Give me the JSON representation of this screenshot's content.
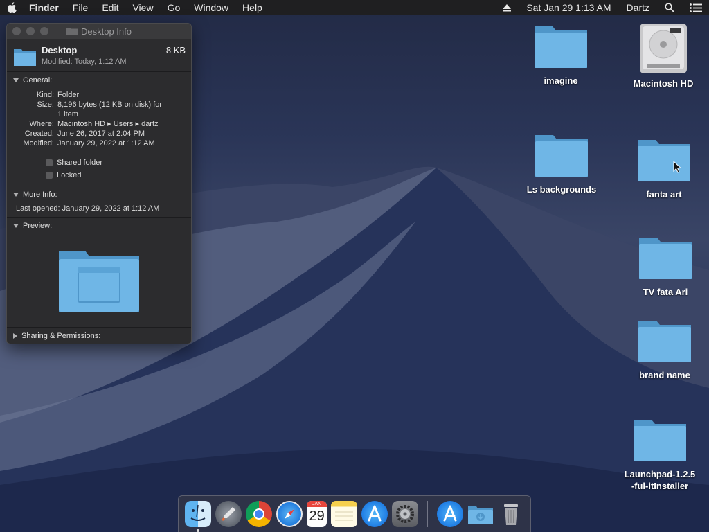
{
  "menubar": {
    "app": "Finder",
    "items": [
      "File",
      "Edit",
      "View",
      "Go",
      "Window",
      "Help"
    ],
    "clock": "Sat Jan 29  1:13 AM",
    "user": "Dartz"
  },
  "info_window": {
    "title": "Desktop Info",
    "name": "Desktop",
    "size": "8 KB",
    "modified_short": "Modified: Today, 1:12 AM",
    "general": {
      "title": "General:",
      "kind_label": "Kind:",
      "kind": "Folder",
      "size_label": "Size:",
      "size_line1": "8,196 bytes (12 KB on disk) for",
      "size_line2": "1 item",
      "where_label": "Where:",
      "where": "Macintosh HD ▸ Users ▸ dartz",
      "created_label": "Created:",
      "created": "June 26, 2017 at 2:04 PM",
      "modified_label": "Modified:",
      "modified": "January 29, 2022 at 1:12 AM",
      "shared": "Shared folder",
      "locked": "Locked"
    },
    "more_info": {
      "title": "More Info:",
      "last_opened": "Last opened: January 29, 2022 at 1:12 AM"
    },
    "preview": {
      "title": "Preview:"
    },
    "sharing": {
      "title": "Sharing & Permissions:"
    }
  },
  "desktop_icons": [
    {
      "label": "imagine"
    },
    {
      "label": "Macintosh HD"
    },
    {
      "label": "Ls backgrounds"
    },
    {
      "label": "fanta art"
    },
    {
      "label": "TV fata Ari"
    },
    {
      "label": "brand name"
    },
    {
      "label": "Launchpad-1.2.5-ful-itInstaller",
      "line1": "Launchpad-1.2.5",
      "line2": "-ful-itInstaller"
    }
  ],
  "dock": {
    "calendar_month": "JAN",
    "calendar_day": "29",
    "apps": [
      "finder",
      "launchpad",
      "chrome",
      "safari",
      "calendar",
      "notes",
      "app-store",
      "system-preferences",
      "app-store-downloads",
      "downloads-folder",
      "trash"
    ]
  },
  "colors": {
    "folder": "#6fb6e6",
    "folder_dark": "#4f96c9",
    "menubar": "#1f1f21",
    "window": "#2c2c2e"
  }
}
